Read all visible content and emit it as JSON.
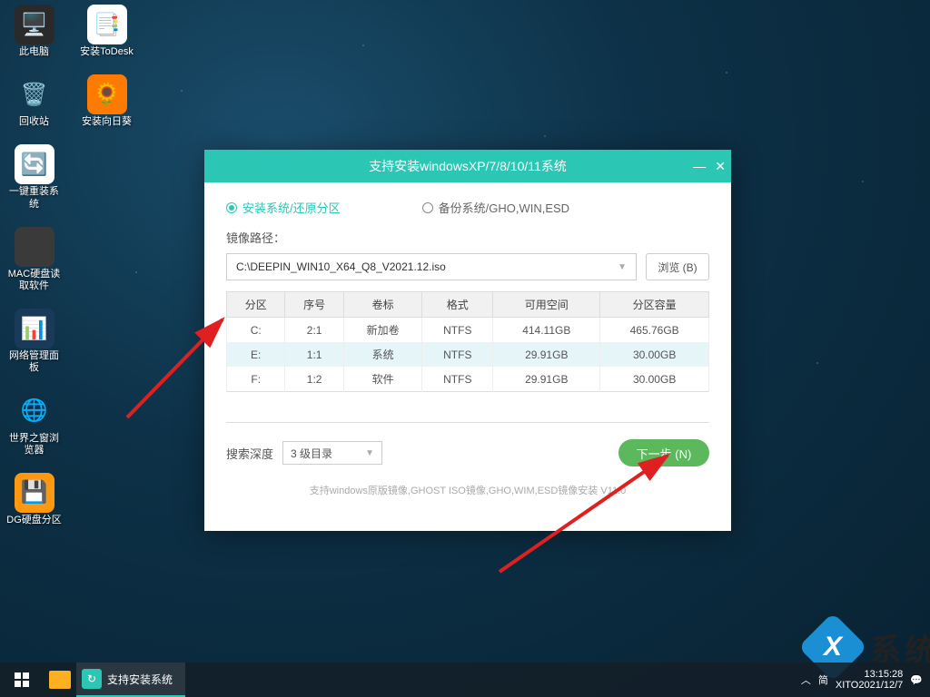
{
  "desktop": {
    "icons_col1": [
      {
        "name": "pc-icon",
        "label": "此电脑",
        "cls": "ic-pc",
        "glyph": "🖥️"
      },
      {
        "name": "recycle-icon",
        "label": "回收站",
        "cls": "ic-recycle",
        "glyph": "🗑️"
      },
      {
        "name": "reinstall-icon",
        "label": "一键重装系统",
        "cls": "ic-reinstall",
        "glyph": "🔄"
      },
      {
        "name": "mac-icon",
        "label": "MAC硬盘读取软件",
        "cls": "ic-mac",
        "glyph": ""
      },
      {
        "name": "netpanel-icon",
        "label": "网络管理面板",
        "cls": "ic-net",
        "glyph": "📊"
      },
      {
        "name": "browser-icon",
        "label": "世界之窗浏览器",
        "cls": "ic-browser",
        "glyph": "🌐"
      },
      {
        "name": "dg-icon",
        "label": "DG硬盘分区",
        "cls": "ic-dg",
        "glyph": "💾"
      }
    ],
    "icons_col2": [
      {
        "name": "todesk-icon",
        "label": "安装ToDesk",
        "cls": "ic-todesk",
        "glyph": "📑"
      },
      {
        "name": "sunflower-icon",
        "label": "安装向日葵",
        "cls": "ic-sunflower",
        "glyph": "🌻"
      }
    ]
  },
  "dialog": {
    "title": "支持安装windowsXP/7/8/10/11系统",
    "radio_install": "安装系统/还原分区",
    "radio_backup": "备份系统/GHO,WIN,ESD",
    "image_path_label": "镜像路径：",
    "image_path_value": "C:\\DEEPIN_WIN10_X64_Q8_V2021.12.iso",
    "browse_label": "浏览 (B)",
    "table": {
      "headers": [
        "分区",
        "序号",
        "卷标",
        "格式",
        "可用空间",
        "分区容量"
      ],
      "rows": [
        {
          "drive": "C:",
          "index": "2:1",
          "label": "新加卷",
          "fs": "NTFS",
          "free": "414.11GB",
          "total": "465.76GB",
          "sel": false
        },
        {
          "drive": "E:",
          "index": "1:1",
          "label": "系统",
          "fs": "NTFS",
          "free": "29.91GB",
          "total": "30.00GB",
          "sel": true
        },
        {
          "drive": "F:",
          "index": "1:2",
          "label": "软件",
          "fs": "NTFS",
          "free": "29.91GB",
          "total": "30.00GB",
          "sel": false
        }
      ]
    },
    "search_depth_label": "搜索深度",
    "search_depth_value": "3 级目录",
    "next_label": "下一步 (N)",
    "footer": "支持windows原版镜像,GHOST ISO镜像,GHO,WIM,ESD镜像安装 V11.0"
  },
  "taskbar": {
    "active_task": "支持安装系统",
    "ime": "简",
    "time": "13:15:28",
    "date": "XITO2021/12/7"
  },
  "watermark": {
    "letter": "X",
    "text": "系统"
  }
}
